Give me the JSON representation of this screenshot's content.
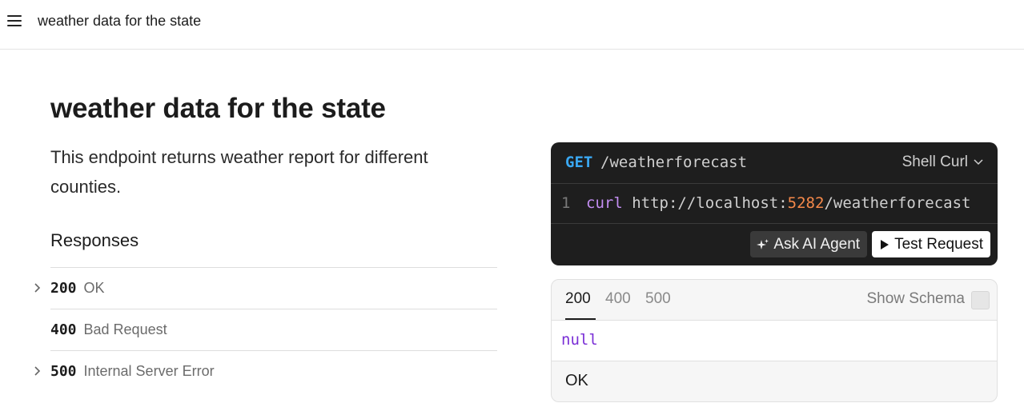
{
  "topbar": {
    "title": "weather data for the state"
  },
  "page": {
    "title": "weather data for the state",
    "description": "This endpoint returns weather report for different counties."
  },
  "responses": {
    "heading": "Responses",
    "items": [
      {
        "code": "200",
        "text": "OK",
        "expandable": true
      },
      {
        "code": "400",
        "text": "Bad Request",
        "expandable": false
      },
      {
        "code": "500",
        "text": "Internal Server Error",
        "expandable": true
      }
    ]
  },
  "request": {
    "method": "GET",
    "path": "/weatherforecast",
    "language": "Shell Curl",
    "line_number": "1",
    "code": {
      "cmd": "curl",
      "prefix": " http://localhost:",
      "port": "5282",
      "suffix": "/weatherforecast"
    },
    "ask_ai_label": "Ask AI Agent",
    "test_label": "Test Request"
  },
  "response_panel": {
    "tabs": [
      "200",
      "400",
      "500"
    ],
    "active_tab": "200",
    "show_schema_label": "Show Schema",
    "body": "null",
    "description": "OK"
  },
  "colors": {
    "method": "#3aa8f2",
    "command": "#c38df2",
    "port": "#f5894a",
    "null": "#7a2fd6"
  }
}
